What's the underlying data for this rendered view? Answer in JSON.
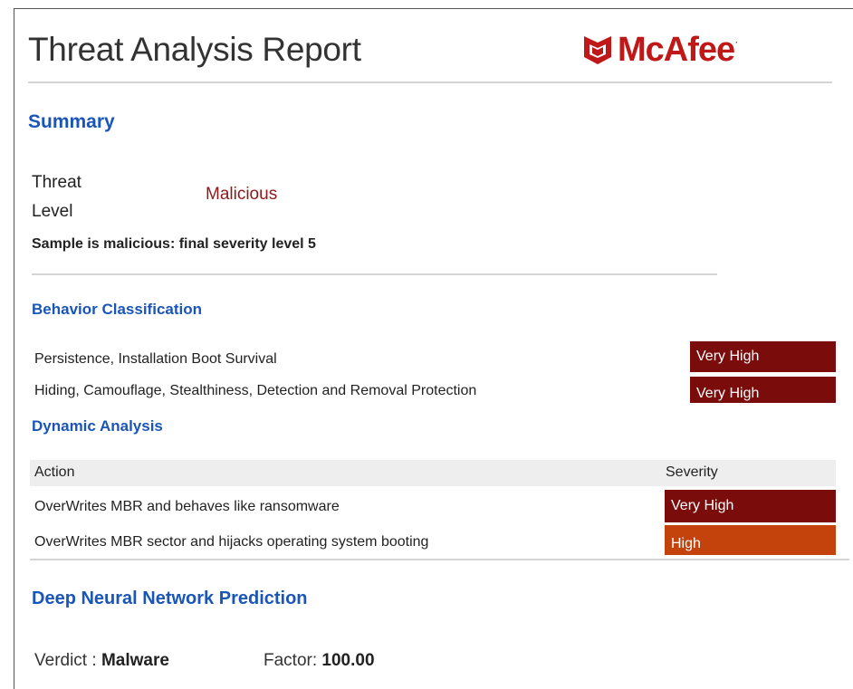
{
  "report": {
    "title": "Threat Analysis Report",
    "brand": "McAfee",
    "brand_color": "#c01818"
  },
  "summary": {
    "heading": "Summary",
    "threat_level_label": "Threat Level",
    "threat_level_value": "Malicious",
    "description": "Sample is malicious: final severity level 5"
  },
  "behavior_classification": {
    "heading": "Behavior Classification",
    "rows": [
      {
        "label": "Persistence, Installation Boot Survival",
        "severity": "Very High"
      },
      {
        "label": "Hiding, Camouflage, Stealthiness, Detection and Removal Protection",
        "severity": "Very High"
      }
    ]
  },
  "dynamic_analysis": {
    "heading": "Dynamic Analysis",
    "columns": {
      "action": "Action",
      "severity": "Severity"
    },
    "rows": [
      {
        "action": "OverWrites MBR and behaves like ransomware",
        "severity": "Very High"
      },
      {
        "action": "OverWrites MBR sector and hijacks operating system booting",
        "severity": "High"
      }
    ]
  },
  "dnn_prediction": {
    "heading": "Deep Neural Network Prediction",
    "verdict_label": "Verdict :",
    "verdict_value": "Malware",
    "factor_label": "Factor:",
    "factor_value": "100.00"
  },
  "colors": {
    "very_high": "#7a0c0c",
    "high": "#c4420b",
    "heading_blue": "#1a55b8"
  }
}
